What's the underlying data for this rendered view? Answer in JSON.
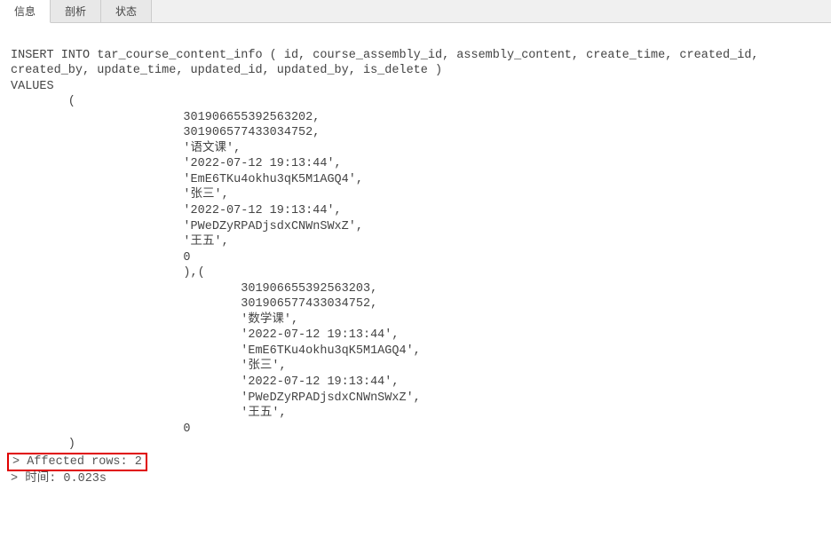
{
  "tabs": {
    "info": "信息",
    "profile": "剖析",
    "status": "状态"
  },
  "sql": {
    "line1": "INSERT INTO tar_course_content_info ( id, course_assembly_id, assembly_content, create_time, created_id,",
    "line2": "created_by, update_time, updated_id, updated_by, is_delete )",
    "line3": "VALUES",
    "openParen": "        (",
    "row1": {
      "v1": "                        301906655392563202,",
      "v2": "                        301906577433034752,",
      "v3": "                        '语文课',",
      "v4": "                        '2022-07-12 19:13:44',",
      "v5": "                        'EmE6TKu4okhu3qK5M1AGQ4',",
      "v6": "                        '张三',",
      "v7": "                        '2022-07-12 19:13:44',",
      "v8": "                        'PWeDZyRPADjsdxCNWnSWxZ',",
      "v9": "                        '王五',",
      "v10": "                        0 ",
      "close": "                        ),("
    },
    "row2": {
      "v1": "                                301906655392563203,",
      "v2": "                                301906577433034752,",
      "v3": "                                '数学课',",
      "v4": "                                '2022-07-12 19:13:44',",
      "v5": "                                'EmE6TKu4okhu3qK5M1AGQ4',",
      "v6": "                                '张三',",
      "v7": "                                '2022-07-12 19:13:44',",
      "v8": "                                'PWeDZyRPADjsdxCNWnSWxZ',",
      "v9": "                                '王五',",
      "v10": "                        0 "
    },
    "closeParen": "        )"
  },
  "result": {
    "affected": "> Affected rows: 2",
    "time": "> 时间: 0.023s"
  }
}
